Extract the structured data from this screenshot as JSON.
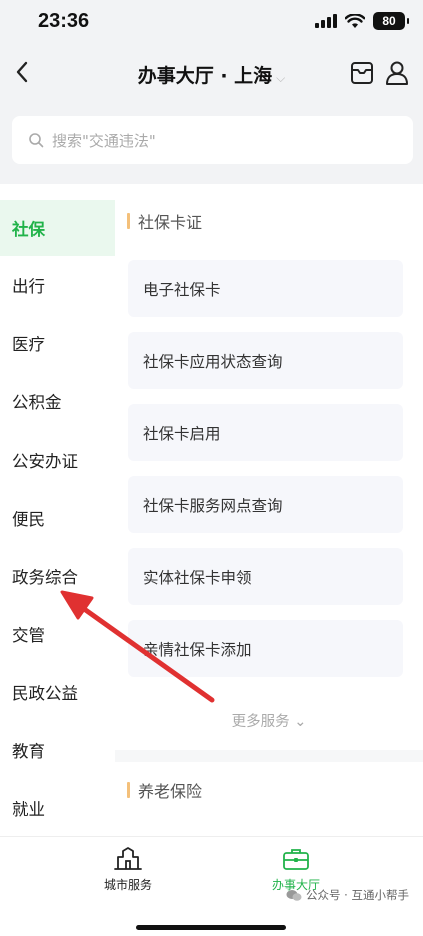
{
  "status": {
    "time": "23:36",
    "battery": "80"
  },
  "nav": {
    "title": "办事大厅 · 上海"
  },
  "search": {
    "placeholder": "搜索\"交通违法\""
  },
  "sidebar": {
    "items": [
      {
        "label": "社保",
        "active": true
      },
      {
        "label": "出行"
      },
      {
        "label": "医疗"
      },
      {
        "label": "公积金"
      },
      {
        "label": "公安办证"
      },
      {
        "label": "便民"
      },
      {
        "label": "政务综合"
      },
      {
        "label": "交管"
      },
      {
        "label": "民政公益"
      },
      {
        "label": "教育"
      },
      {
        "label": "就业"
      }
    ]
  },
  "sections": [
    {
      "title": "社保卡证",
      "services": [
        "电子社保卡",
        "社保卡应用状态查询",
        "社保卡启用",
        "社保卡服务网点查询",
        "实体社保卡申领",
        "亲情社保卡添加"
      ],
      "more": "更多服务"
    },
    {
      "title": "养老保险"
    }
  ],
  "tabs": [
    {
      "label": "城市服务",
      "active": false
    },
    {
      "label": "办事大厅",
      "active": true
    }
  ],
  "watermark": "公众号 · 互通小帮手",
  "colors": {
    "accent": "#21b34a",
    "arrow": "#e03131",
    "section_bar": "#f4c07a"
  }
}
